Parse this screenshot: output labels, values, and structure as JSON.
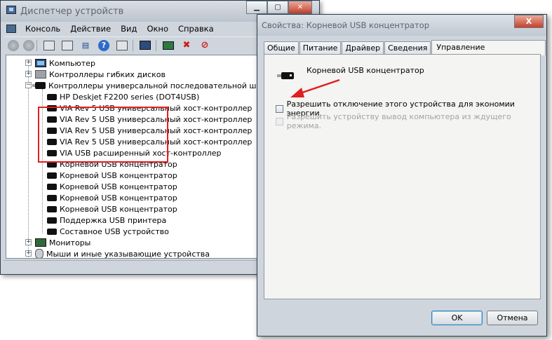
{
  "devmgr": {
    "title": "Диспетчер устройств",
    "menu": [
      "Консоль",
      "Действие",
      "Вид",
      "Окно",
      "Справка"
    ],
    "tree": {
      "computer": "Компьютер",
      "floppy": "Контроллеры гибких дисков",
      "usb_controllers": "Контроллеры универсальной последовательной шины USB",
      "usb_children": [
        "HP Deskjet F2200 series (DOT4USB)",
        "VIA Rev 5 USB универсальный хост-контроллер",
        "VIA Rev 5 USB универсальный хост-контроллер",
        "VIA Rev 5 USB универсальный хост-контроллер",
        "VIA Rev 5 USB универсальный хост-контроллер",
        "VIA USB расширенный хост-контроллер",
        "Корневой USB концентратор",
        "Корневой USB концентратор",
        "Корневой USB концентратор",
        "Корневой USB концентратор",
        "Корневой USB концентратор",
        "Поддержка USB принтера",
        "Составное USB устройство"
      ],
      "monitors": "Мониторы",
      "mice": "Мыши и иные указывающие устройства"
    }
  },
  "props": {
    "title": "Свойства: Корневой USB концентратор",
    "close_label": "X",
    "tabs": [
      "Общие",
      "Питание",
      "Драйвер",
      "Сведения",
      "Управление электропитанием"
    ],
    "active_tab": 4,
    "device_name": "Корневой USB концентратор",
    "options": [
      {
        "label": "Разрешить отключение этого устройства для экономии энергии.",
        "enabled": true,
        "checked": false
      },
      {
        "label": "Разрешить устройству вывод компьютера из ждущего режима.",
        "enabled": false,
        "checked": false
      }
    ],
    "ok_label": "OK",
    "cancel_label": "Отмена"
  },
  "colors": {
    "highlight": "#e02020",
    "arrow": "#e02020"
  }
}
